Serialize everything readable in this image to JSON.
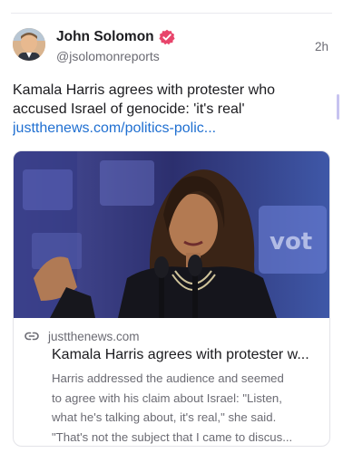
{
  "post": {
    "author_name": "John Solomon",
    "author_handle": "@jsolomonreports",
    "timestamp": "2h",
    "verified": true,
    "text": "Kamala Harris agrees with protester who accused Israel of genocide: 'it's real'",
    "link_text": "justthenews.com/politics-polic..."
  },
  "link_card": {
    "domain": "justthenews.com",
    "title": "Kamala Harris agrees with protester w...",
    "description_lines": [
      "Harris addressed the audience and seemed",
      "to agree with his claim about Israel: \"Listen,",
      "what he's talking about, it's real,\" she said.",
      "\"That's not the subject that I came to discus..."
    ]
  },
  "icons": {
    "verified": "verified-badge-icon",
    "link": "link-icon"
  },
  "colors": {
    "link": "#1f6fd1",
    "verified_badge": "#e8456b",
    "muted_text": "#6b6b73",
    "photo_background": "#3a3f8f"
  }
}
